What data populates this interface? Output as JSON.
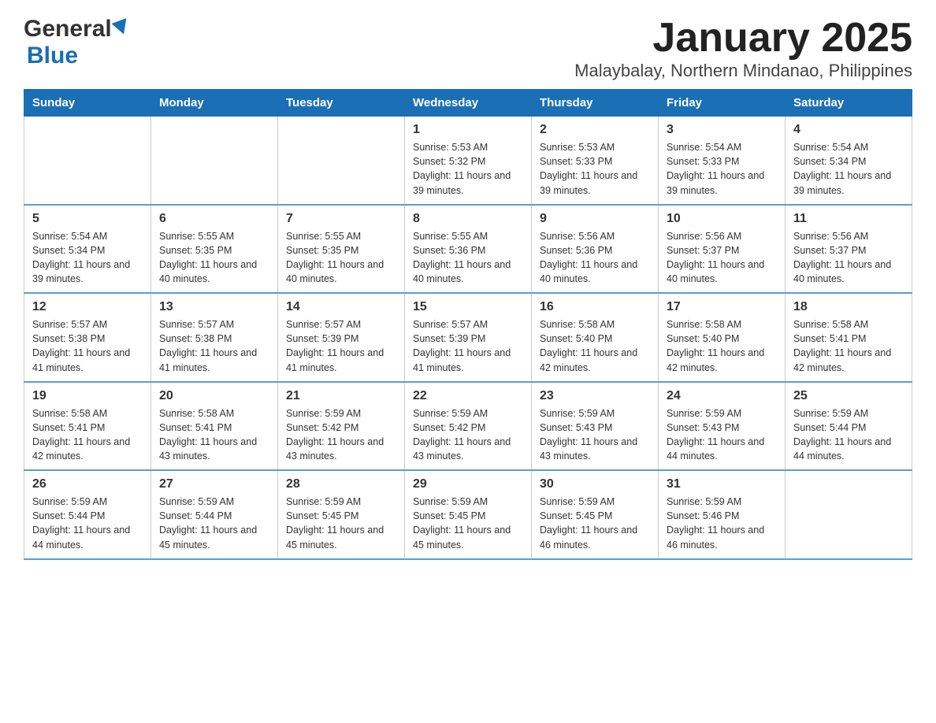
{
  "logo": {
    "general": "General",
    "blue": "Blue"
  },
  "title": "January 2025",
  "subtitle": "Malaybalay, Northern Mindanao, Philippines",
  "days_of_week": [
    "Sunday",
    "Monday",
    "Tuesday",
    "Wednesday",
    "Thursday",
    "Friday",
    "Saturday"
  ],
  "weeks": [
    [
      {
        "day": "",
        "info": ""
      },
      {
        "day": "",
        "info": ""
      },
      {
        "day": "",
        "info": ""
      },
      {
        "day": "1",
        "info": "Sunrise: 5:53 AM\nSunset: 5:32 PM\nDaylight: 11 hours and 39 minutes."
      },
      {
        "day": "2",
        "info": "Sunrise: 5:53 AM\nSunset: 5:33 PM\nDaylight: 11 hours and 39 minutes."
      },
      {
        "day": "3",
        "info": "Sunrise: 5:54 AM\nSunset: 5:33 PM\nDaylight: 11 hours and 39 minutes."
      },
      {
        "day": "4",
        "info": "Sunrise: 5:54 AM\nSunset: 5:34 PM\nDaylight: 11 hours and 39 minutes."
      }
    ],
    [
      {
        "day": "5",
        "info": "Sunrise: 5:54 AM\nSunset: 5:34 PM\nDaylight: 11 hours and 39 minutes."
      },
      {
        "day": "6",
        "info": "Sunrise: 5:55 AM\nSunset: 5:35 PM\nDaylight: 11 hours and 40 minutes."
      },
      {
        "day": "7",
        "info": "Sunrise: 5:55 AM\nSunset: 5:35 PM\nDaylight: 11 hours and 40 minutes."
      },
      {
        "day": "8",
        "info": "Sunrise: 5:55 AM\nSunset: 5:36 PM\nDaylight: 11 hours and 40 minutes."
      },
      {
        "day": "9",
        "info": "Sunrise: 5:56 AM\nSunset: 5:36 PM\nDaylight: 11 hours and 40 minutes."
      },
      {
        "day": "10",
        "info": "Sunrise: 5:56 AM\nSunset: 5:37 PM\nDaylight: 11 hours and 40 minutes."
      },
      {
        "day": "11",
        "info": "Sunrise: 5:56 AM\nSunset: 5:37 PM\nDaylight: 11 hours and 40 minutes."
      }
    ],
    [
      {
        "day": "12",
        "info": "Sunrise: 5:57 AM\nSunset: 5:38 PM\nDaylight: 11 hours and 41 minutes."
      },
      {
        "day": "13",
        "info": "Sunrise: 5:57 AM\nSunset: 5:38 PM\nDaylight: 11 hours and 41 minutes."
      },
      {
        "day": "14",
        "info": "Sunrise: 5:57 AM\nSunset: 5:39 PM\nDaylight: 11 hours and 41 minutes."
      },
      {
        "day": "15",
        "info": "Sunrise: 5:57 AM\nSunset: 5:39 PM\nDaylight: 11 hours and 41 minutes."
      },
      {
        "day": "16",
        "info": "Sunrise: 5:58 AM\nSunset: 5:40 PM\nDaylight: 11 hours and 42 minutes."
      },
      {
        "day": "17",
        "info": "Sunrise: 5:58 AM\nSunset: 5:40 PM\nDaylight: 11 hours and 42 minutes."
      },
      {
        "day": "18",
        "info": "Sunrise: 5:58 AM\nSunset: 5:41 PM\nDaylight: 11 hours and 42 minutes."
      }
    ],
    [
      {
        "day": "19",
        "info": "Sunrise: 5:58 AM\nSunset: 5:41 PM\nDaylight: 11 hours and 42 minutes."
      },
      {
        "day": "20",
        "info": "Sunrise: 5:58 AM\nSunset: 5:41 PM\nDaylight: 11 hours and 43 minutes."
      },
      {
        "day": "21",
        "info": "Sunrise: 5:59 AM\nSunset: 5:42 PM\nDaylight: 11 hours and 43 minutes."
      },
      {
        "day": "22",
        "info": "Sunrise: 5:59 AM\nSunset: 5:42 PM\nDaylight: 11 hours and 43 minutes."
      },
      {
        "day": "23",
        "info": "Sunrise: 5:59 AM\nSunset: 5:43 PM\nDaylight: 11 hours and 43 minutes."
      },
      {
        "day": "24",
        "info": "Sunrise: 5:59 AM\nSunset: 5:43 PM\nDaylight: 11 hours and 44 minutes."
      },
      {
        "day": "25",
        "info": "Sunrise: 5:59 AM\nSunset: 5:44 PM\nDaylight: 11 hours and 44 minutes."
      }
    ],
    [
      {
        "day": "26",
        "info": "Sunrise: 5:59 AM\nSunset: 5:44 PM\nDaylight: 11 hours and 44 minutes."
      },
      {
        "day": "27",
        "info": "Sunrise: 5:59 AM\nSunset: 5:44 PM\nDaylight: 11 hours and 45 minutes."
      },
      {
        "day": "28",
        "info": "Sunrise: 5:59 AM\nSunset: 5:45 PM\nDaylight: 11 hours and 45 minutes."
      },
      {
        "day": "29",
        "info": "Sunrise: 5:59 AM\nSunset: 5:45 PM\nDaylight: 11 hours and 45 minutes."
      },
      {
        "day": "30",
        "info": "Sunrise: 5:59 AM\nSunset: 5:45 PM\nDaylight: 11 hours and 46 minutes."
      },
      {
        "day": "31",
        "info": "Sunrise: 5:59 AM\nSunset: 5:46 PM\nDaylight: 11 hours and 46 minutes."
      },
      {
        "day": "",
        "info": ""
      }
    ]
  ]
}
